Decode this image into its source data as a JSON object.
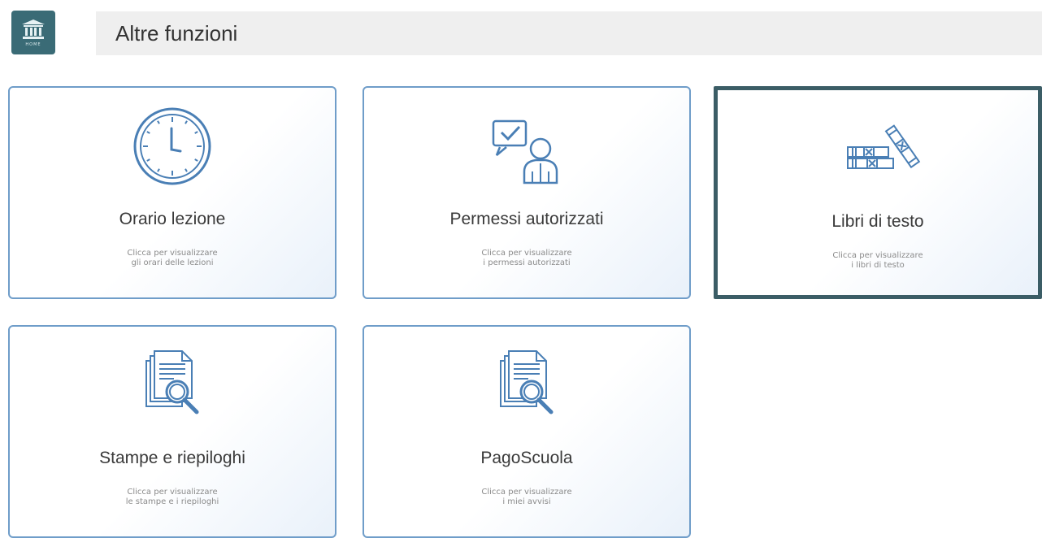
{
  "header": {
    "home_icon": "bank-icon",
    "home_label": "HOME",
    "title": "Altre funzioni"
  },
  "cards": [
    {
      "title": "Orario lezione",
      "sub_line1": "Clicca per visualizzare",
      "sub_line2": "gli orari delle lezioni",
      "icon": "clock-icon"
    },
    {
      "title": "Permessi autorizzati",
      "sub_line1": "Clicca per visualizzare",
      "sub_line2": "i permessi autorizzati",
      "icon": "user-check-icon"
    },
    {
      "title": "Libri di testo",
      "sub_line1": "Clicca per visualizzare",
      "sub_line2": "i libri di testo",
      "icon": "books-icon"
    },
    {
      "title": "Stampe e riepiloghi",
      "sub_line1": "Clicca per visualizzare",
      "sub_line2": "le stampe e i riepiloghi",
      "icon": "document-search-icon"
    },
    {
      "title": "PagoScuola",
      "sub_line1": "Clicca per visualizzare",
      "sub_line2": "i miei avvisi",
      "icon": "document-search-icon"
    }
  ],
  "colors": {
    "accent": "#3a6b76",
    "card_border": "#6f9dc9",
    "icon_stroke": "#4a7fb5",
    "selected_border": "#3b5d66"
  }
}
